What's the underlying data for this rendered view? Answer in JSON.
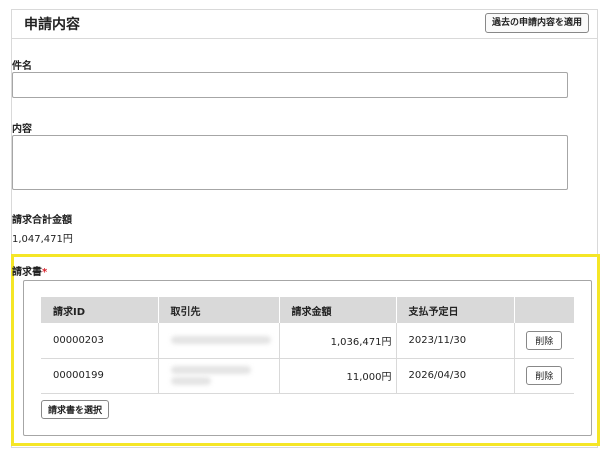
{
  "panel": {
    "title": "申請内容",
    "apply_past_label": "過去の申請内容を適用"
  },
  "fields": {
    "subject_label": "件名",
    "subject_value": "",
    "content_label": "内容",
    "content_value": "",
    "total_label": "請求合計金額",
    "total_value": "1,047,471円"
  },
  "invoices": {
    "label": "請求書",
    "required_mark": "*",
    "columns": [
      "請求ID",
      "取引先",
      "請求金額",
      "支払予定日",
      ""
    ],
    "rows": [
      {
        "id": "00000203",
        "partner": "",
        "amount": "1,036,471円",
        "due_date": "2023/11/30",
        "delete_label": "削除"
      },
      {
        "id": "00000199",
        "partner": "",
        "amount": "11,000円",
        "due_date": "2026/04/30",
        "delete_label": "削除"
      }
    ],
    "select_label": "請求書を選択"
  },
  "colors": {
    "highlight": "#f5e626",
    "required": "#d9212b",
    "table_header": "#d9d9d9"
  }
}
